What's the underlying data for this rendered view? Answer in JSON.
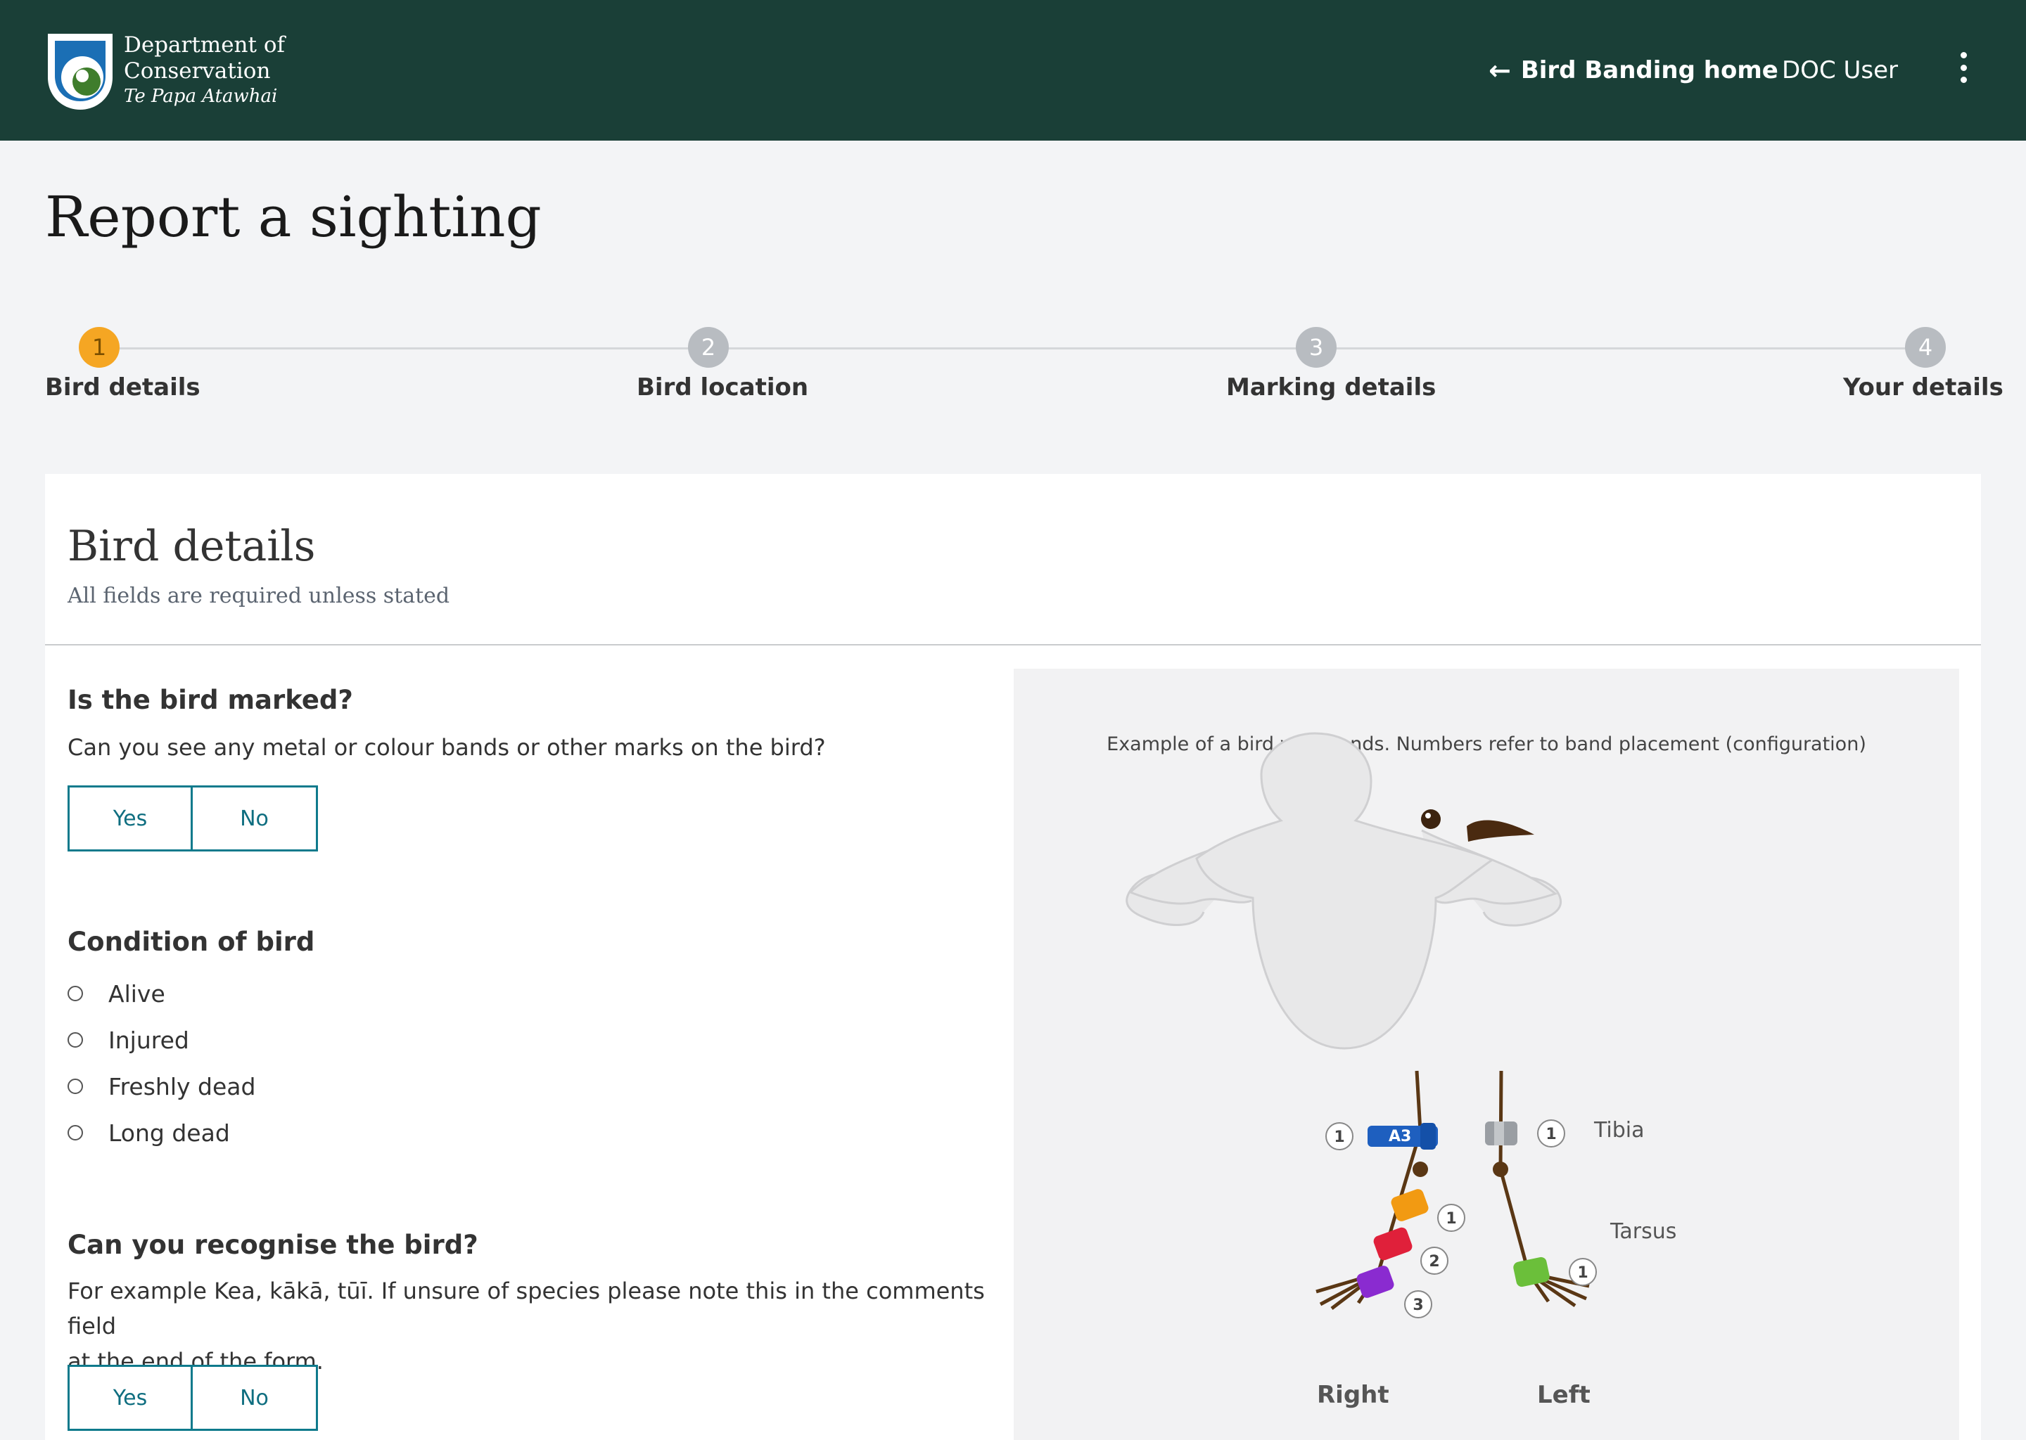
{
  "header": {
    "logo": {
      "line1": "Department of",
      "line2": "Conservation",
      "line3": "Te Papa Atawhai"
    },
    "nav_home": "Bird Banding home",
    "user": "DOC User",
    "colors": {
      "bar": "#1a3f37",
      "logo_blue": "#1b6fb5",
      "logo_green": "#3f7d2c"
    }
  },
  "page": {
    "title": "Report a sighting"
  },
  "stepper": {
    "active_color": "#f5a623",
    "steps": [
      {
        "number": "1",
        "label": "Bird details",
        "active": true
      },
      {
        "number": "2",
        "label": "Bird location",
        "active": false
      },
      {
        "number": "3",
        "label": "Marking details",
        "active": false
      },
      {
        "number": "4",
        "label": "Your details",
        "active": false
      }
    ]
  },
  "section": {
    "title": "Bird details",
    "subtitle": "All fields are required unless stated"
  },
  "q_marked": {
    "title": "Is the bird marked?",
    "help": "Can you see any metal or colour bands or other marks on the bird?",
    "yes": "Yes",
    "no": "No"
  },
  "q_condition": {
    "title": "Condition of bird",
    "options": [
      "Alive",
      "Injured",
      "Freshly dead",
      "Long dead"
    ]
  },
  "q_recognise": {
    "title": "Can you recognise the bird?",
    "help_line1": "For example Kea, kākā, tūī. If unsure of species please note this in the comments field",
    "help_line2": "at the end of the form.",
    "yes": "Yes",
    "no": "No"
  },
  "example": {
    "caption": "Example of a bird with bands. Numbers refer to band placement (configuration)",
    "band_text": "A3",
    "labels": {
      "tibia": "Tibia",
      "tarsus": "Tarsus",
      "right": "Right",
      "left": "Left"
    },
    "numbers": [
      "1",
      "1",
      "1",
      "2",
      "3",
      "1"
    ],
    "band_colors": {
      "blue": "#1e5fbf",
      "grey": "#9a9ea3",
      "orange": "#f29a12",
      "red": "#e0203a",
      "purple": "#8a2bd0",
      "green": "#6bbf3a"
    }
  }
}
